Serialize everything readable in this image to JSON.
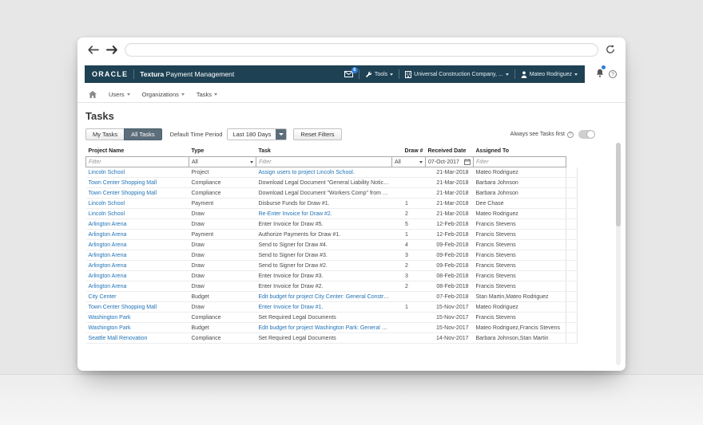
{
  "colors": {
    "header_bg": "#1e4154",
    "link_blue": "#2173b6",
    "selected_button_bg": "#5b6e7a",
    "badge_blue": "#2f7ed8"
  },
  "browser": {
    "url_value": ""
  },
  "header": {
    "logo": "ORACLE",
    "product_bold": "Textura",
    "product_rest": "Payment Management",
    "mail_badge": "6",
    "tools_label": "Tools",
    "company_label": "Universal Construction Company, ...",
    "user_label": "Mateo Rodriguez",
    "help_label": "?"
  },
  "nav": {
    "items": [
      {
        "label": "Users"
      },
      {
        "label": "Organizations"
      },
      {
        "label": "Tasks"
      }
    ]
  },
  "page": {
    "title": "Tasks"
  },
  "toolbar": {
    "my_tasks_label": "My Tasks",
    "all_tasks_label": "All Tasks",
    "time_period_label": "Default Time Period",
    "time_period_value": "Last 180 Days",
    "reset_filters_label": "Reset Filters",
    "always_see_label": "Always see Tasks first"
  },
  "table": {
    "columns": [
      "Project Name",
      "Type",
      "Task",
      "Draw #",
      "Received Date",
      "Assigned To"
    ],
    "filters": {
      "project_placeholder": "Filter",
      "type_value": "All",
      "task_placeholder": "Filter",
      "draw_value": "All",
      "date_value": "07-Oct-2017",
      "assigned_placeholder": "Filter"
    },
    "rows": [
      {
        "project": "Lincoln School",
        "type": "Project",
        "task": "Assign users to project Lincoln School.",
        "task_is_link": true,
        "draw": "",
        "date": "21-Mar-2018",
        "assigned": "Mateo Rodriguez"
      },
      {
        "project": "Town Center Shopping Mall",
        "type": "Compliance",
        "task": "Download Legal Document \"General Liability Notice\" from Green ...",
        "task_is_link": false,
        "draw": "",
        "date": "21-Mar-2018",
        "assigned": "Barbara Johnson"
      },
      {
        "project": "Town Center Shopping Mall",
        "type": "Compliance",
        "task": "Download Legal Document \"Workers Comp\" from Green Corp.",
        "task_is_link": false,
        "draw": "",
        "date": "21-Mar-2018",
        "assigned": "Barbara Johnson"
      },
      {
        "project": "Lincoln School",
        "type": "Payment",
        "task": "Disburse Funds for Draw #1.",
        "task_is_link": false,
        "draw": "1",
        "date": "21-Mar-2018",
        "assigned": "Dee Chase"
      },
      {
        "project": "Lincoln School",
        "type": "Draw",
        "task": "Re-Enter Invoice for Draw #2.",
        "task_is_link": true,
        "draw": "2",
        "date": "21-Mar-2018",
        "assigned": "Mateo Rodriguez"
      },
      {
        "project": "Arlington Arena",
        "type": "Draw",
        "task": "Enter Invoice for Draw #5.",
        "task_is_link": false,
        "draw": "5",
        "date": "12-Feb-2018",
        "assigned": "Francis Stevens"
      },
      {
        "project": "Arlington Arena",
        "type": "Payment",
        "task": "Authorize Payments for Draw #1.",
        "task_is_link": false,
        "draw": "1",
        "date": "12-Feb-2018",
        "assigned": "Francis Stevens"
      },
      {
        "project": "Arlington Arena",
        "type": "Draw",
        "task": "Send to Signer for Draw #4.",
        "task_is_link": false,
        "draw": "4",
        "date": "09-Feb-2018",
        "assigned": "Francis Stevens"
      },
      {
        "project": "Arlington Arena",
        "type": "Draw",
        "task": "Send to Signer for Draw #3.",
        "task_is_link": false,
        "draw": "3",
        "date": "09-Feb-2018",
        "assigned": "Francis Stevens"
      },
      {
        "project": "Arlington Arena",
        "type": "Draw",
        "task": "Send to Signer for Draw #2.",
        "task_is_link": false,
        "draw": "2",
        "date": "09-Feb-2018",
        "assigned": "Francis Stevens"
      },
      {
        "project": "Arlington Arena",
        "type": "Draw",
        "task": "Enter Invoice for Draw #3.",
        "task_is_link": false,
        "draw": "3",
        "date": "08-Feb-2018",
        "assigned": "Francis Stevens"
      },
      {
        "project": "Arlington Arena",
        "type": "Draw",
        "task": "Enter Invoice for Draw #2.",
        "task_is_link": false,
        "draw": "2",
        "date": "08-Feb-2018",
        "assigned": "Francis Stevens"
      },
      {
        "project": "City Center",
        "type": "Budget",
        "task": "Edit budget for project City Center: General Construction.",
        "task_is_link": true,
        "draw": "",
        "date": "07-Feb-2018",
        "assigned": "Stan Martin,Mateo Rodriguez"
      },
      {
        "project": "Town Center Shopping Mall",
        "type": "Draw",
        "task": "Enter Invoice for Draw #1.",
        "task_is_link": true,
        "draw": "1",
        "date": "15-Nov-2017",
        "assigned": "Mateo Rodriguez"
      },
      {
        "project": "Washington Park",
        "type": "Compliance",
        "task": "Set Required Legal Documents",
        "task_is_link": false,
        "draw": "",
        "date": "15-Nov-2017",
        "assigned": "Francis Stevens"
      },
      {
        "project": "Washington Park",
        "type": "Budget",
        "task": "Edit budget for project Washington Park: General Construction.",
        "task_is_link": true,
        "draw": "",
        "date": "15-Nov-2017",
        "assigned": "Mateo Rodriguez,Francis Stevens"
      },
      {
        "project": "Seattle Mall Renovation",
        "type": "Compliance",
        "task": "Set Required Legal Documents",
        "task_is_link": false,
        "draw": "",
        "date": "14-Nov-2017",
        "assigned": "Barbara Johnson,Stan Martin"
      }
    ]
  }
}
